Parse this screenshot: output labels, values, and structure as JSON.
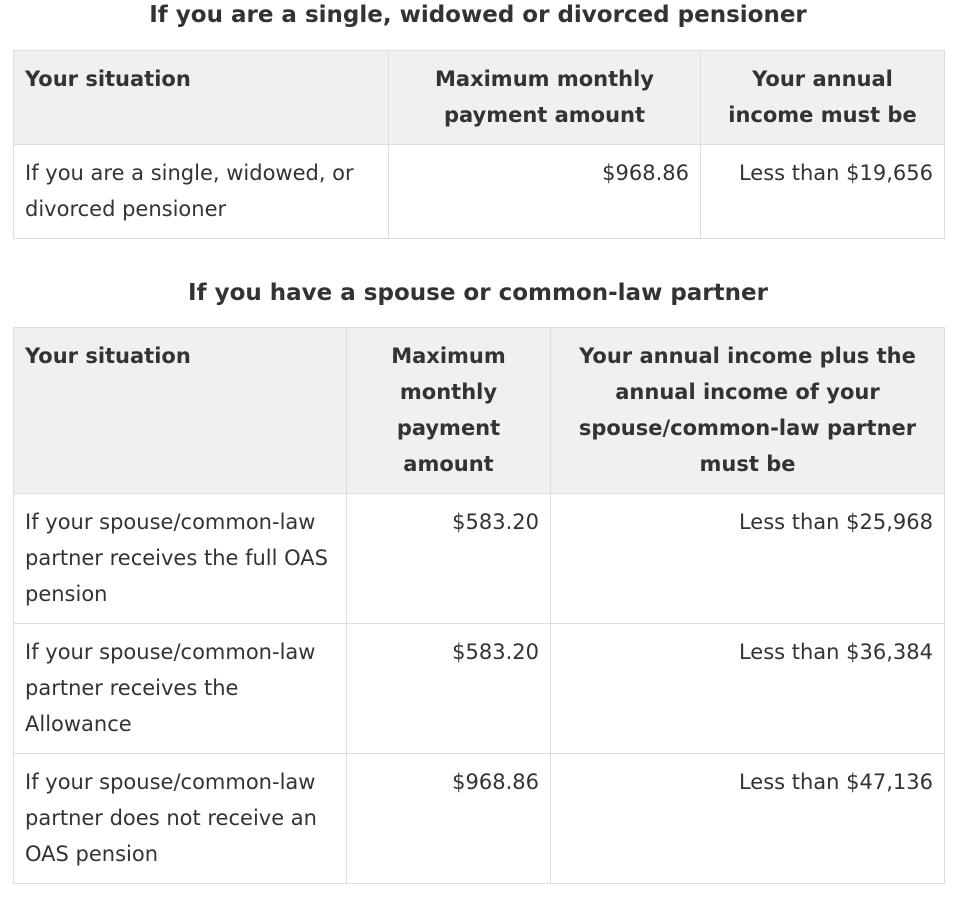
{
  "table1": {
    "caption": "If you are a single, widowed or divorced pensioner",
    "headers": [
      "Your situation",
      "Maximum monthly payment amount",
      "Your annual income must be"
    ],
    "rows": [
      [
        "If you are a single, widowed, or divorced pensioner",
        "$968.86",
        "Less than $19,656"
      ]
    ]
  },
  "table2": {
    "caption": "If you have a spouse or common-law partner",
    "headers": [
      "Your situation",
      "Maximum monthly payment amount",
      "Your annual income plus the annual income of your spouse/common-law partner must be"
    ],
    "rows": [
      [
        "If your spouse/common-law partner receives the full OAS pension",
        "$583.20",
        "Less than $25,968"
      ],
      [
        "If your spouse/common-law partner receives the Allowance",
        "$583.20",
        "Less than $36,384"
      ],
      [
        "If your spouse/common-law partner does not receive an OAS pension",
        "$968.86",
        "Less than $47,136"
      ]
    ]
  }
}
